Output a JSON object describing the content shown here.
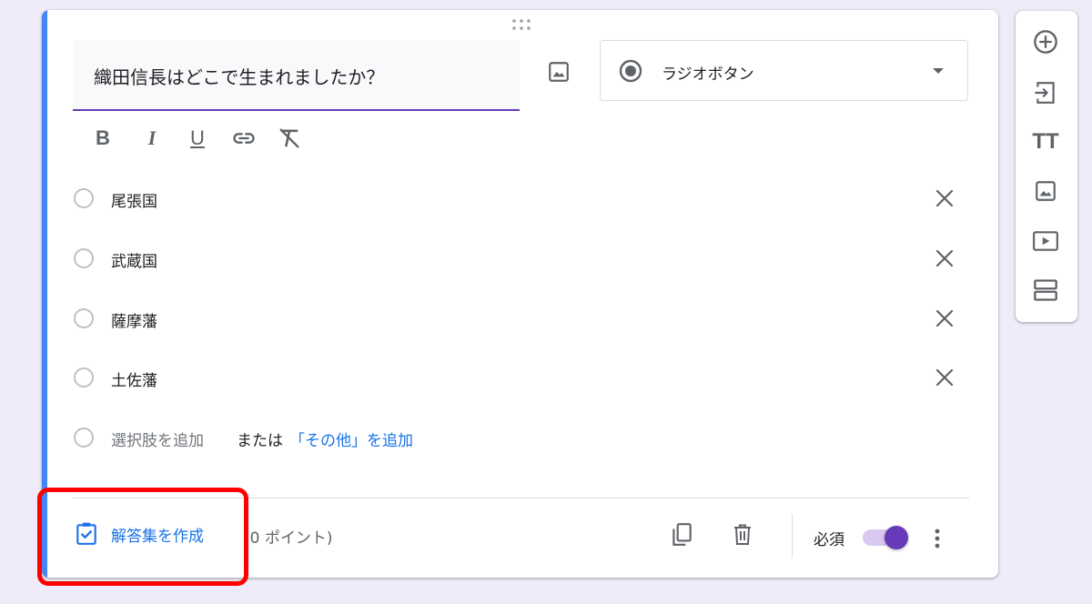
{
  "question": {
    "title": "織田信長はどこで生まれましたか？",
    "type_label": "ラジオボタン",
    "type_icon": "radio-checked-icon"
  },
  "formatting": {
    "bold_label": "B",
    "italic_label": "I",
    "underline_label": "U",
    "link_icon": "link-icon",
    "clear_icon": "clear-format-icon"
  },
  "options": [
    {
      "label": "尾張国"
    },
    {
      "label": "武蔵国"
    },
    {
      "label": "薩摩藩"
    },
    {
      "label": "土佐藩"
    }
  ],
  "add_row": {
    "add_option_label": "選択肢を追加",
    "or_label": "または",
    "add_other_label": "「その他」を追加"
  },
  "footer": {
    "answer_key_label": "解答集を作成",
    "points_label": "(0 ポイント)",
    "required_label": "必須",
    "required_on": true
  },
  "side_toolbar": {
    "items": [
      {
        "icon": "add-circle-icon"
      },
      {
        "icon": "import-icon"
      },
      {
        "icon": "title-icon"
      },
      {
        "icon": "image-icon"
      },
      {
        "icon": "video-icon"
      },
      {
        "icon": "section-icon"
      }
    ],
    "title_glyph": "TT"
  },
  "colors": {
    "accent": "#673ab7",
    "card_edge": "#4285f4",
    "link": "#1a73e8",
    "highlight": "#ff0000",
    "background": "#f0ebf8"
  }
}
